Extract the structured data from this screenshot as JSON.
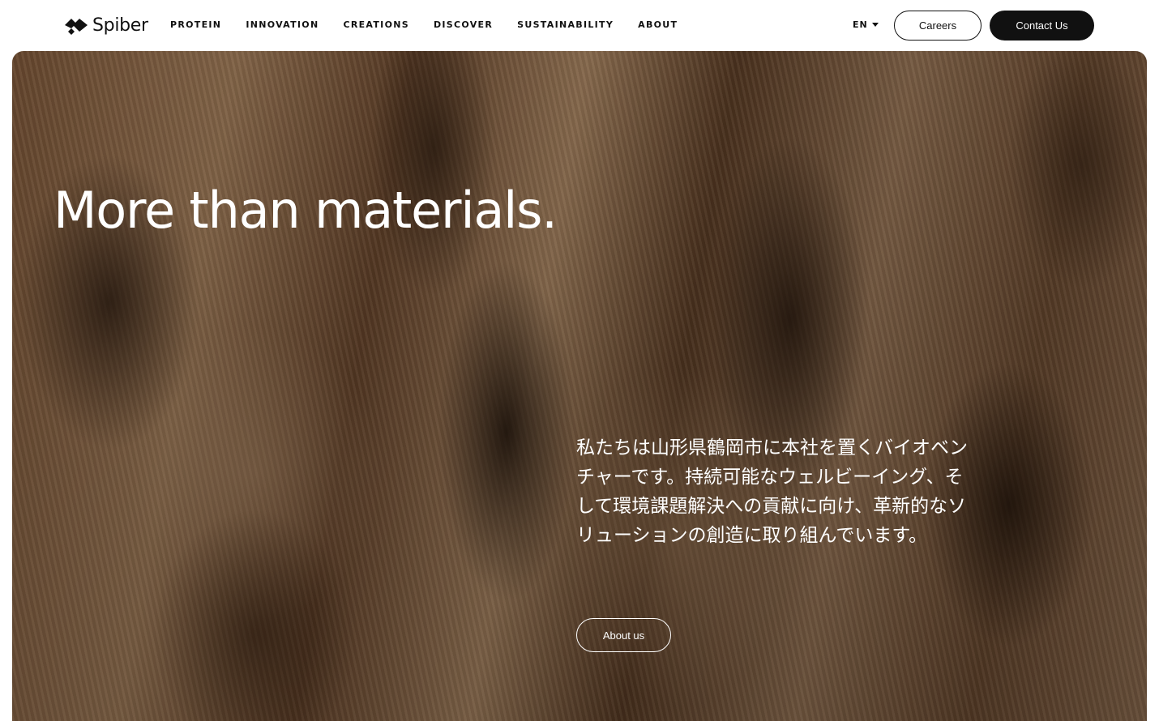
{
  "brand": {
    "name": "Spiber"
  },
  "nav": {
    "items": [
      {
        "label": "PROTEIN"
      },
      {
        "label": "INNOVATION"
      },
      {
        "label": "CREATIONS"
      },
      {
        "label": "DISCOVER"
      },
      {
        "label": "SUSTAINABILITY"
      },
      {
        "label": "ABOUT"
      }
    ]
  },
  "language": {
    "selected": "EN"
  },
  "header_buttons": {
    "careers_label": "Careers",
    "contact_label": "Contact Us"
  },
  "hero": {
    "title": "More than materials.",
    "description": "私たちは山形県鶴岡市に本社を置くバイオベンチャーです。持続可能なウェルビーイング、そして環境課題解決への貢献に向け、革新的なソリューションの創造に取り組んでいます。",
    "cta_label": "About us"
  },
  "colors": {
    "text": "#111111",
    "contact_button_bg": "#111111",
    "hero_text": "#ffffff"
  }
}
